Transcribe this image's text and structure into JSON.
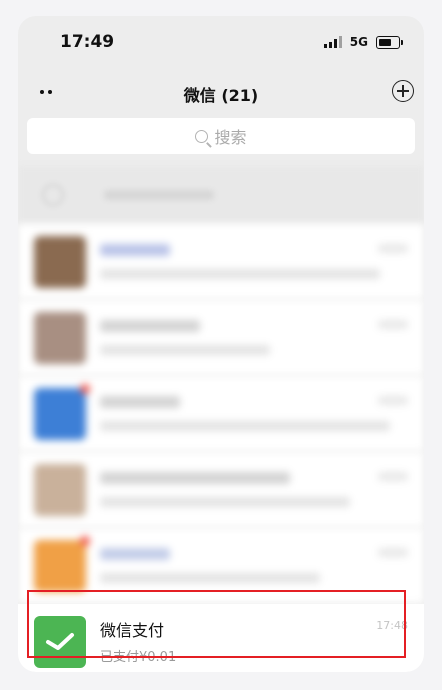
{
  "status_bar": {
    "time": "17:49",
    "network": "5G"
  },
  "navbar": {
    "title": "微信 (21)"
  },
  "search": {
    "placeholder": "搜索"
  },
  "chats": [
    {
      "avatar_color": "#8a6a50",
      "name_color": "#b9c3e8",
      "unread": false
    },
    {
      "avatar_color": "#a88f82",
      "name_color": "#d3d3d3",
      "unread": false
    },
    {
      "avatar_color": "#3d7fd6",
      "name_color": "#d3d3d3",
      "unread": true
    },
    {
      "avatar_color": "#c9b19b",
      "name_color": "#d3d3d3",
      "unread": false
    },
    {
      "avatar_color": "#f0a046",
      "name_color": "#c2cce8",
      "unread": true
    }
  ],
  "pay_chat": {
    "name": "微信支付",
    "message": "已支付¥0.01",
    "time": "17:48",
    "avatar_color": "#4cb553"
  },
  "colors": {
    "highlight": "#e41f24",
    "background": "#ededed"
  }
}
